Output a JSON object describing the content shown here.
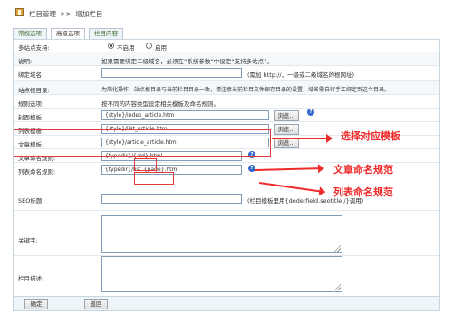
{
  "breadcrumb": {
    "part1": "栏目管理",
    "sep": ">>",
    "part2": "增加栏目"
  },
  "tabs": [
    "常规选项",
    "高级选项",
    "栏目内容"
  ],
  "rows": [
    {
      "label": "多站点支持:",
      "radio_no": "不启用",
      "radio_yes": "启用"
    },
    {
      "label": "说明:",
      "text": "如果需要绑定二级域名，必须在“系统参数”中设定“支持多站点”。"
    },
    {
      "label": "绑定域名:",
      "hint": "(需加 http://，一级或二级域名的根网址)"
    },
    {
      "label": "站点根目录:",
      "text": "为简化操作，站点根目录与当前栏目目录一致，请注意当前栏目文件保存目录的设置，域名需自行手工绑定到这个目录。"
    },
    {
      "label": "规则选项:",
      "text": "按不同的内容类型设定相关模板及命名规则。"
    },
    {
      "label": "封面模板:",
      "value": "{style}/index_article.htm",
      "browse": "浏览..."
    },
    {
      "label": "列表模板:",
      "value": "{style}/list_article.htm",
      "browse": "浏览..."
    },
    {
      "label": "文章模板:",
      "value": "{style}/article_article.htm",
      "browse": "浏览..."
    },
    {
      "label": "文章命名规则:",
      "value_a": "{typedir}/",
      "value_b": "{aid}",
      "value_c": ".html"
    },
    {
      "label": "列表命名规则:",
      "value_a": "{typedir}/",
      "value_b": "list_{page}",
      "value_c": ".html"
    },
    {
      "label": "SEO标题:",
      "hint": "(栏目模板里用{dede:field.seotitle /}调用)"
    },
    {
      "label": "关键字:"
    },
    {
      "label": "栏目描述:"
    }
  ],
  "help_icon": "?",
  "buttons": {
    "confirm": "确定",
    "back": "返回"
  },
  "annotations": [
    "选择对应模板",
    "文章命名规范",
    "列表命名规范"
  ],
  "colors": {
    "annotation": "#ef2b2b",
    "tab_text": "#3b6a2e",
    "help_icon": "#2f68c8"
  }
}
